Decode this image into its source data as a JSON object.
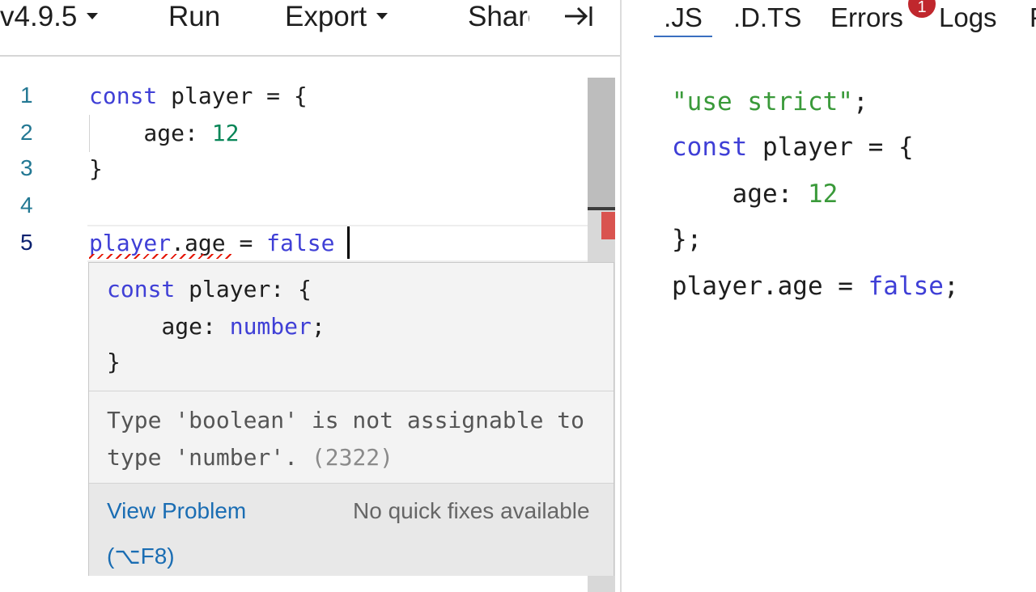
{
  "toolbar": {
    "version": "v4.9.5",
    "run": "Run",
    "export": "Export",
    "share": "Share",
    "collapse_icon": "arrow-to-right-icon"
  },
  "editor": {
    "line_numbers": [
      "1",
      "2",
      "3",
      "4",
      "5"
    ],
    "lines": {
      "l1": {
        "kw": "const",
        "rest": " player = {"
      },
      "l2": {
        "prop": "    age: ",
        "num": "12"
      },
      "l3": {
        "text": "}"
      },
      "l5": {
        "obj": "player",
        "rest": ".age = ",
        "kw": "false"
      }
    }
  },
  "hover": {
    "sig_kw": "const",
    "sig_line1_rest": " player: {",
    "sig_line2_prop": "    age: ",
    "sig_line2_type": "number",
    "sig_line2_end": ";",
    "sig_line3": "}",
    "message": "Type 'boolean' is not assignable to type 'number'.",
    "code": "(2322)",
    "view_problem": "View Problem (⌥F8)",
    "no_fixes": "No quick fixes available"
  },
  "output": {
    "tabs": {
      "js": ".JS",
      "dts": ".D.TS",
      "errors": "Errors",
      "logs": "Logs",
      "more": "P"
    },
    "errors_count": "1",
    "lines": {
      "l1": {
        "str": "\"use strict\"",
        "end": ";"
      },
      "l2": {
        "kw": "const",
        "rest": " player = {"
      },
      "l3": {
        "prop": "    age: ",
        "num": "12"
      },
      "l4": {
        "text": "};"
      },
      "l5": {
        "obj": "player.age = ",
        "kw": "false",
        "end": ";"
      }
    }
  },
  "colors": {
    "keyword": "#3f3fd6",
    "number": "#098658",
    "error": "#e51400",
    "link": "#1a6db3",
    "badge": "#c0272d"
  }
}
